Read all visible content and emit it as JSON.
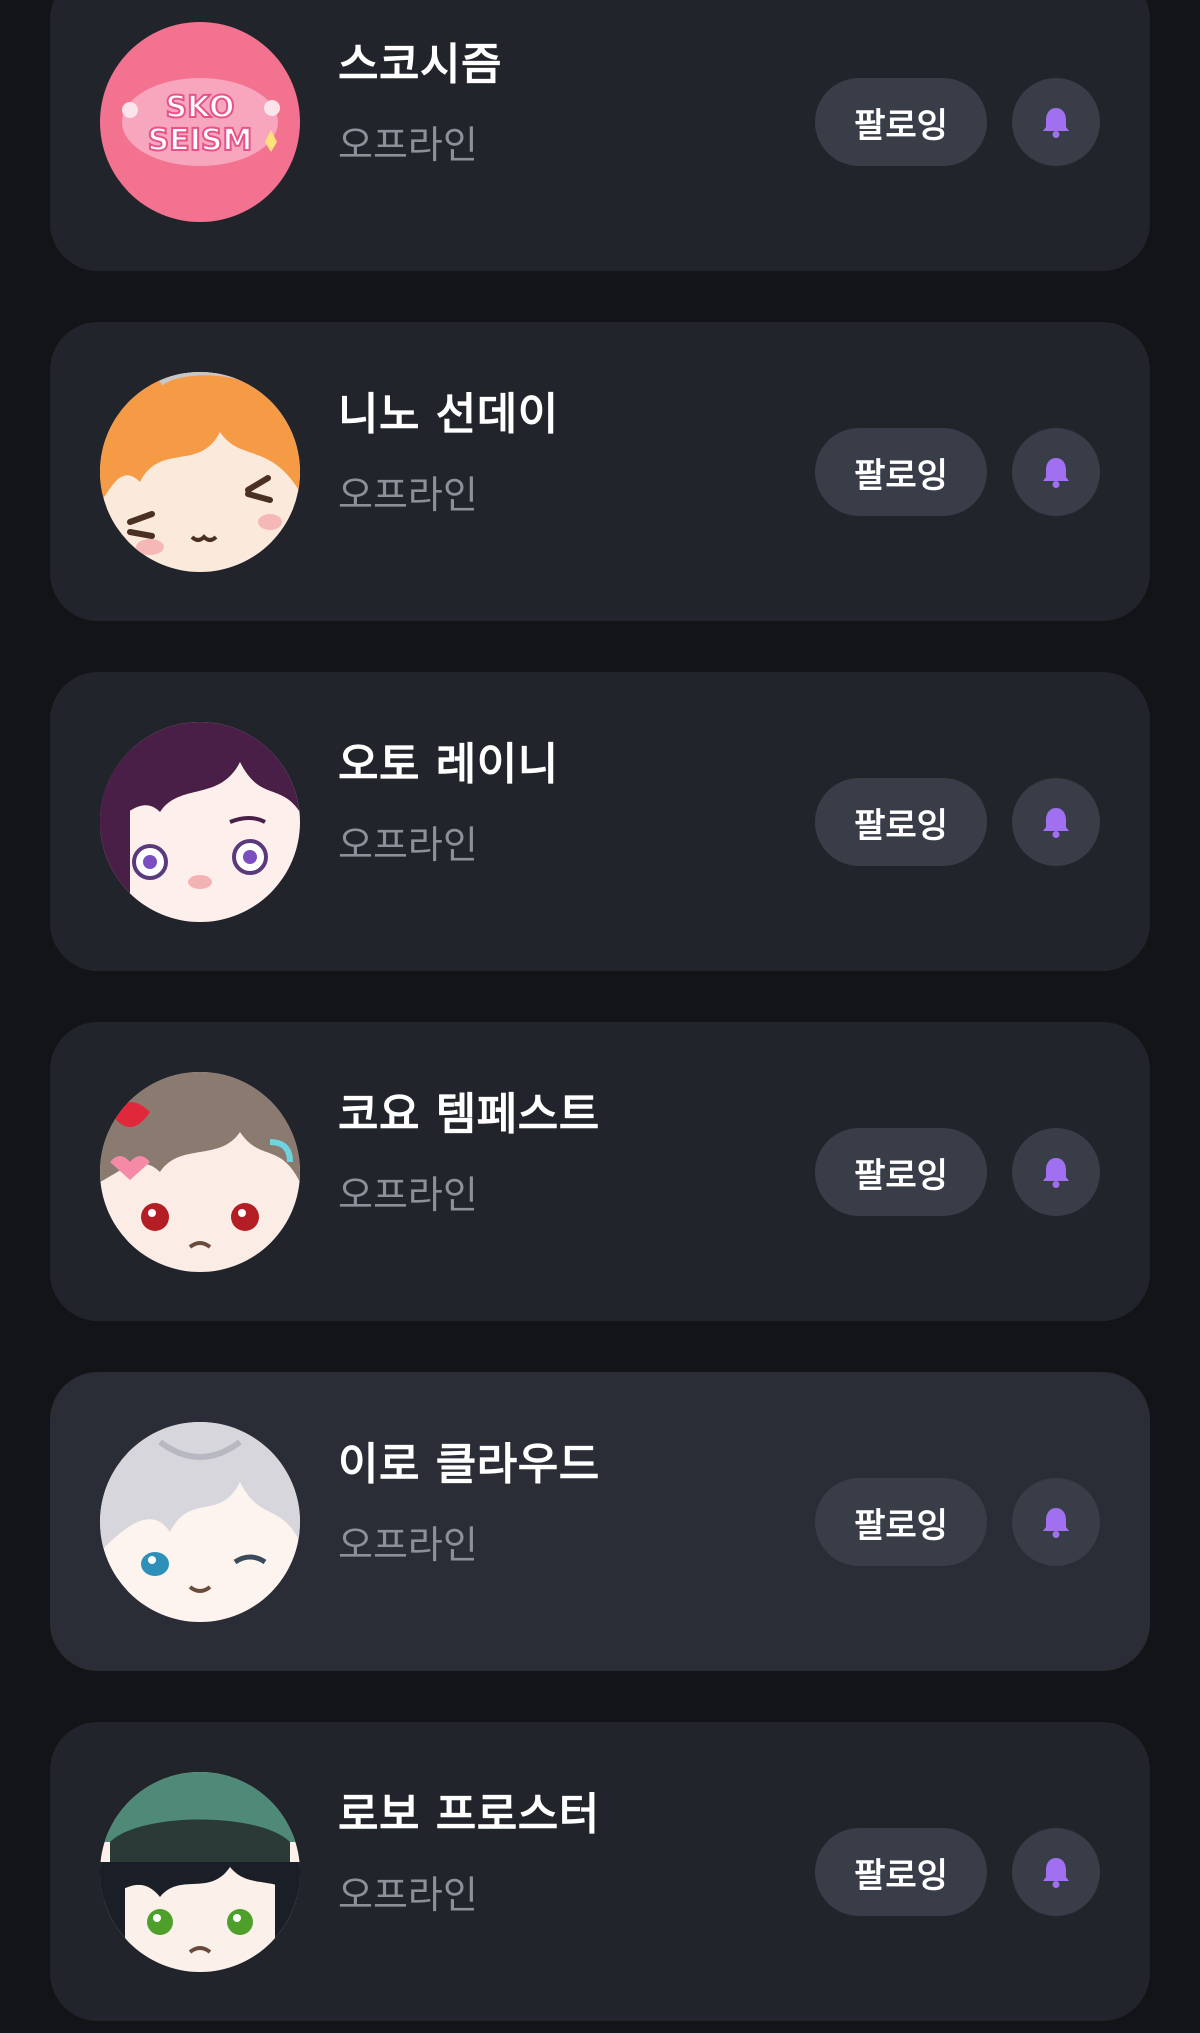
{
  "accent_color": "#a070f0",
  "channels": [
    {
      "name": "스코시즘",
      "status": "오프라인",
      "follow_label": "팔로잉",
      "avatar_icon": "sko-seism-logo-avatar"
    },
    {
      "name": "니노 선데이",
      "status": "오프라인",
      "follow_label": "팔로잉",
      "avatar_icon": "orange-hair-character-avatar"
    },
    {
      "name": "오토 레이니",
      "status": "오프라인",
      "follow_label": "팔로잉",
      "avatar_icon": "purple-hair-character-avatar"
    },
    {
      "name": "코요 템페스트",
      "status": "오프라인",
      "follow_label": "팔로잉",
      "avatar_icon": "brown-hair-character-avatar"
    },
    {
      "name": "이로 클라우드",
      "status": "오프라인",
      "follow_label": "팔로잉",
      "avatar_icon": "silver-hair-character-avatar"
    },
    {
      "name": "로보 프로스터",
      "status": "오프라인",
      "follow_label": "팔로잉",
      "avatar_icon": "green-helmet-character-avatar"
    }
  ],
  "logo_text": [
    "SKO",
    "SEISM"
  ]
}
